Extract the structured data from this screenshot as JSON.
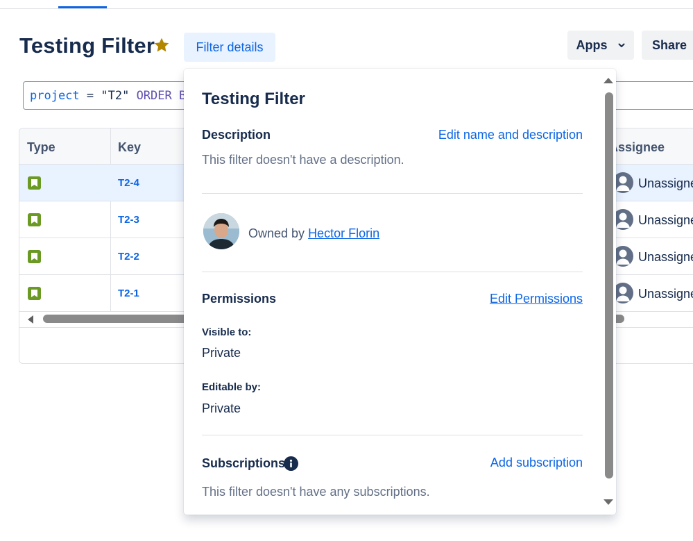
{
  "header": {
    "title": "Testing Filter",
    "filter_details_label": "Filter details",
    "apps_label": "Apps",
    "share_label": "Share"
  },
  "jql": {
    "field": "project",
    "operator": " = ",
    "value": "\"T2\"",
    "keyword": " ORDER BY"
  },
  "table": {
    "columns": [
      "Type",
      "Key",
      "Assignee"
    ],
    "rows": [
      {
        "key": "T2-4",
        "assignee": "Unassigned",
        "selected": true
      },
      {
        "key": "T2-3",
        "assignee": "Unassigned",
        "selected": false
      },
      {
        "key": "T2-2",
        "assignee": "Unassigned",
        "selected": false
      },
      {
        "key": "T2-1",
        "assignee": "Unassigned",
        "selected": false
      }
    ],
    "type_icon": "story-icon"
  },
  "popover": {
    "title": "Testing Filter",
    "description_heading": "Description",
    "edit_name_link": "Edit name and description",
    "description_text": "This filter doesn't have a description.",
    "owned_by_prefix": "Owned by",
    "owner_name": "Hector Florin",
    "permissions_heading": "Permissions",
    "edit_permissions_link": "Edit Permissions",
    "visible_to_label": "Visible to:",
    "visible_to_value": "Private",
    "editable_by_label": "Editable by:",
    "editable_by_value": "Private",
    "subscriptions_heading": "Subscriptions",
    "add_subscription_link": "Add subscription",
    "subscriptions_text": "This filter doesn't have any subscriptions."
  },
  "colors": {
    "primary": "#0c66e4",
    "text": "#172b4d",
    "muted": "#626f86",
    "selected_row": "#e9f2ff",
    "star": "#b38600",
    "story": "#6a9a23"
  }
}
